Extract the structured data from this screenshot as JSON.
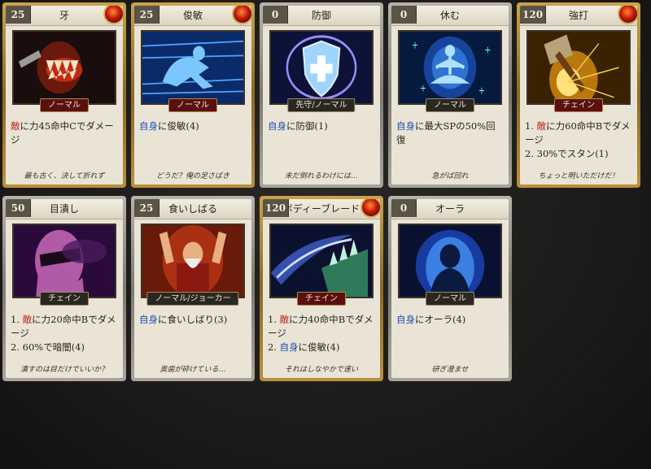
{
  "cards": [
    {
      "cost": "25",
      "name": "牙",
      "tag": "ノーマル",
      "tag_style": "normal-red",
      "frame": "gold",
      "badge": true,
      "lines": [
        {
          "parts": [
            {
              "t": "敵",
              "c": "red"
            },
            {
              "t": "に力45命中Cでダメージ",
              "c": ""
            }
          ]
        }
      ],
      "flavor": "最も古く、決して折れず",
      "art": "fang"
    },
    {
      "cost": "25",
      "name": "俊敏",
      "tag": "ノーマル",
      "tag_style": "normal-red",
      "frame": "gold",
      "badge": true,
      "lines": [
        {
          "parts": [
            {
              "t": "自身",
              "c": "blue"
            },
            {
              "t": "に俊敏(4)",
              "c": ""
            }
          ]
        }
      ],
      "flavor": "どうだ？俺の足さばき",
      "art": "dash"
    },
    {
      "cost": "0",
      "name": "防御",
      "tag": "先守/ノーマル",
      "tag_style": "",
      "frame": "silver",
      "badge": false,
      "lines": [
        {
          "parts": [
            {
              "t": "自身",
              "c": "blue"
            },
            {
              "t": "に防御(1)",
              "c": ""
            }
          ]
        }
      ],
      "flavor": "未だ倒れるわけには…",
      "art": "shield"
    },
    {
      "cost": "0",
      "name": "休む",
      "tag": "ノーマル",
      "tag_style": "",
      "frame": "silver",
      "badge": false,
      "lines": [
        {
          "parts": [
            {
              "t": "自身",
              "c": "blue"
            },
            {
              "t": "に最大SPの50%回復",
              "c": ""
            }
          ]
        }
      ],
      "flavor": "急がば回れ",
      "art": "meditate"
    },
    {
      "cost": "120",
      "name": "強打",
      "tag": "チェイン",
      "tag_style": "chain",
      "frame": "gold",
      "badge": true,
      "lines": [
        {
          "parts": [
            {
              "t": "1. ",
              "c": ""
            },
            {
              "t": "敵",
              "c": "red"
            },
            {
              "t": "に力60命中Bでダメージ",
              "c": ""
            }
          ]
        },
        {
          "parts": [
            {
              "t": "2. 30%でスタン(1)",
              "c": ""
            }
          ]
        }
      ],
      "flavor": "ちょっと明いただけだ！",
      "art": "hammer"
    },
    {
      "cost": "50",
      "name": "目潰し",
      "tag": "チェイン",
      "tag_style": "",
      "frame": "silver",
      "badge": false,
      "lines": [
        {
          "parts": [
            {
              "t": "1. ",
              "c": ""
            },
            {
              "t": "敵",
              "c": "red"
            },
            {
              "t": "に力20命中Bでダメージ",
              "c": ""
            }
          ]
        },
        {
          "parts": [
            {
              "t": "2. 60%で暗闇(4)",
              "c": ""
            }
          ]
        }
      ],
      "flavor": "潰すのは目だけでいいか？",
      "art": "blind"
    },
    {
      "cost": "25",
      "name": "食いしばる",
      "tag": "ノーマル/ジョーカー",
      "tag_style": "",
      "frame": "silver",
      "badge": false,
      "lines": [
        {
          "parts": [
            {
              "t": "自身",
              "c": "blue"
            },
            {
              "t": "に食いしばり(3)",
              "c": ""
            }
          ]
        }
      ],
      "flavor": "奥歯が砕けている…",
      "art": "grit"
    },
    {
      "cost": "120",
      "name": "ボディーブレード",
      "tag": "チェイン",
      "tag_style": "chain",
      "frame": "gold",
      "badge": true,
      "lines": [
        {
          "parts": [
            {
              "t": "1. ",
              "c": ""
            },
            {
              "t": "敵",
              "c": "red"
            },
            {
              "t": "に力40命中Bでダメージ",
              "c": ""
            }
          ]
        },
        {
          "parts": [
            {
              "t": "2. ",
              "c": ""
            },
            {
              "t": "自身",
              "c": "blue"
            },
            {
              "t": "に俊敏(4)",
              "c": ""
            }
          ]
        }
      ],
      "flavor": "それはしなやかで速い",
      "art": "blade"
    },
    {
      "cost": "0",
      "name": "オーラ",
      "tag": "ノーマル",
      "tag_style": "",
      "frame": "silver",
      "badge": false,
      "lines": [
        {
          "parts": [
            {
              "t": "自身",
              "c": "blue"
            },
            {
              "t": "にオーラ(4)",
              "c": ""
            }
          ]
        }
      ],
      "flavor": "研ぎ澄ませ",
      "art": "aura"
    }
  ]
}
